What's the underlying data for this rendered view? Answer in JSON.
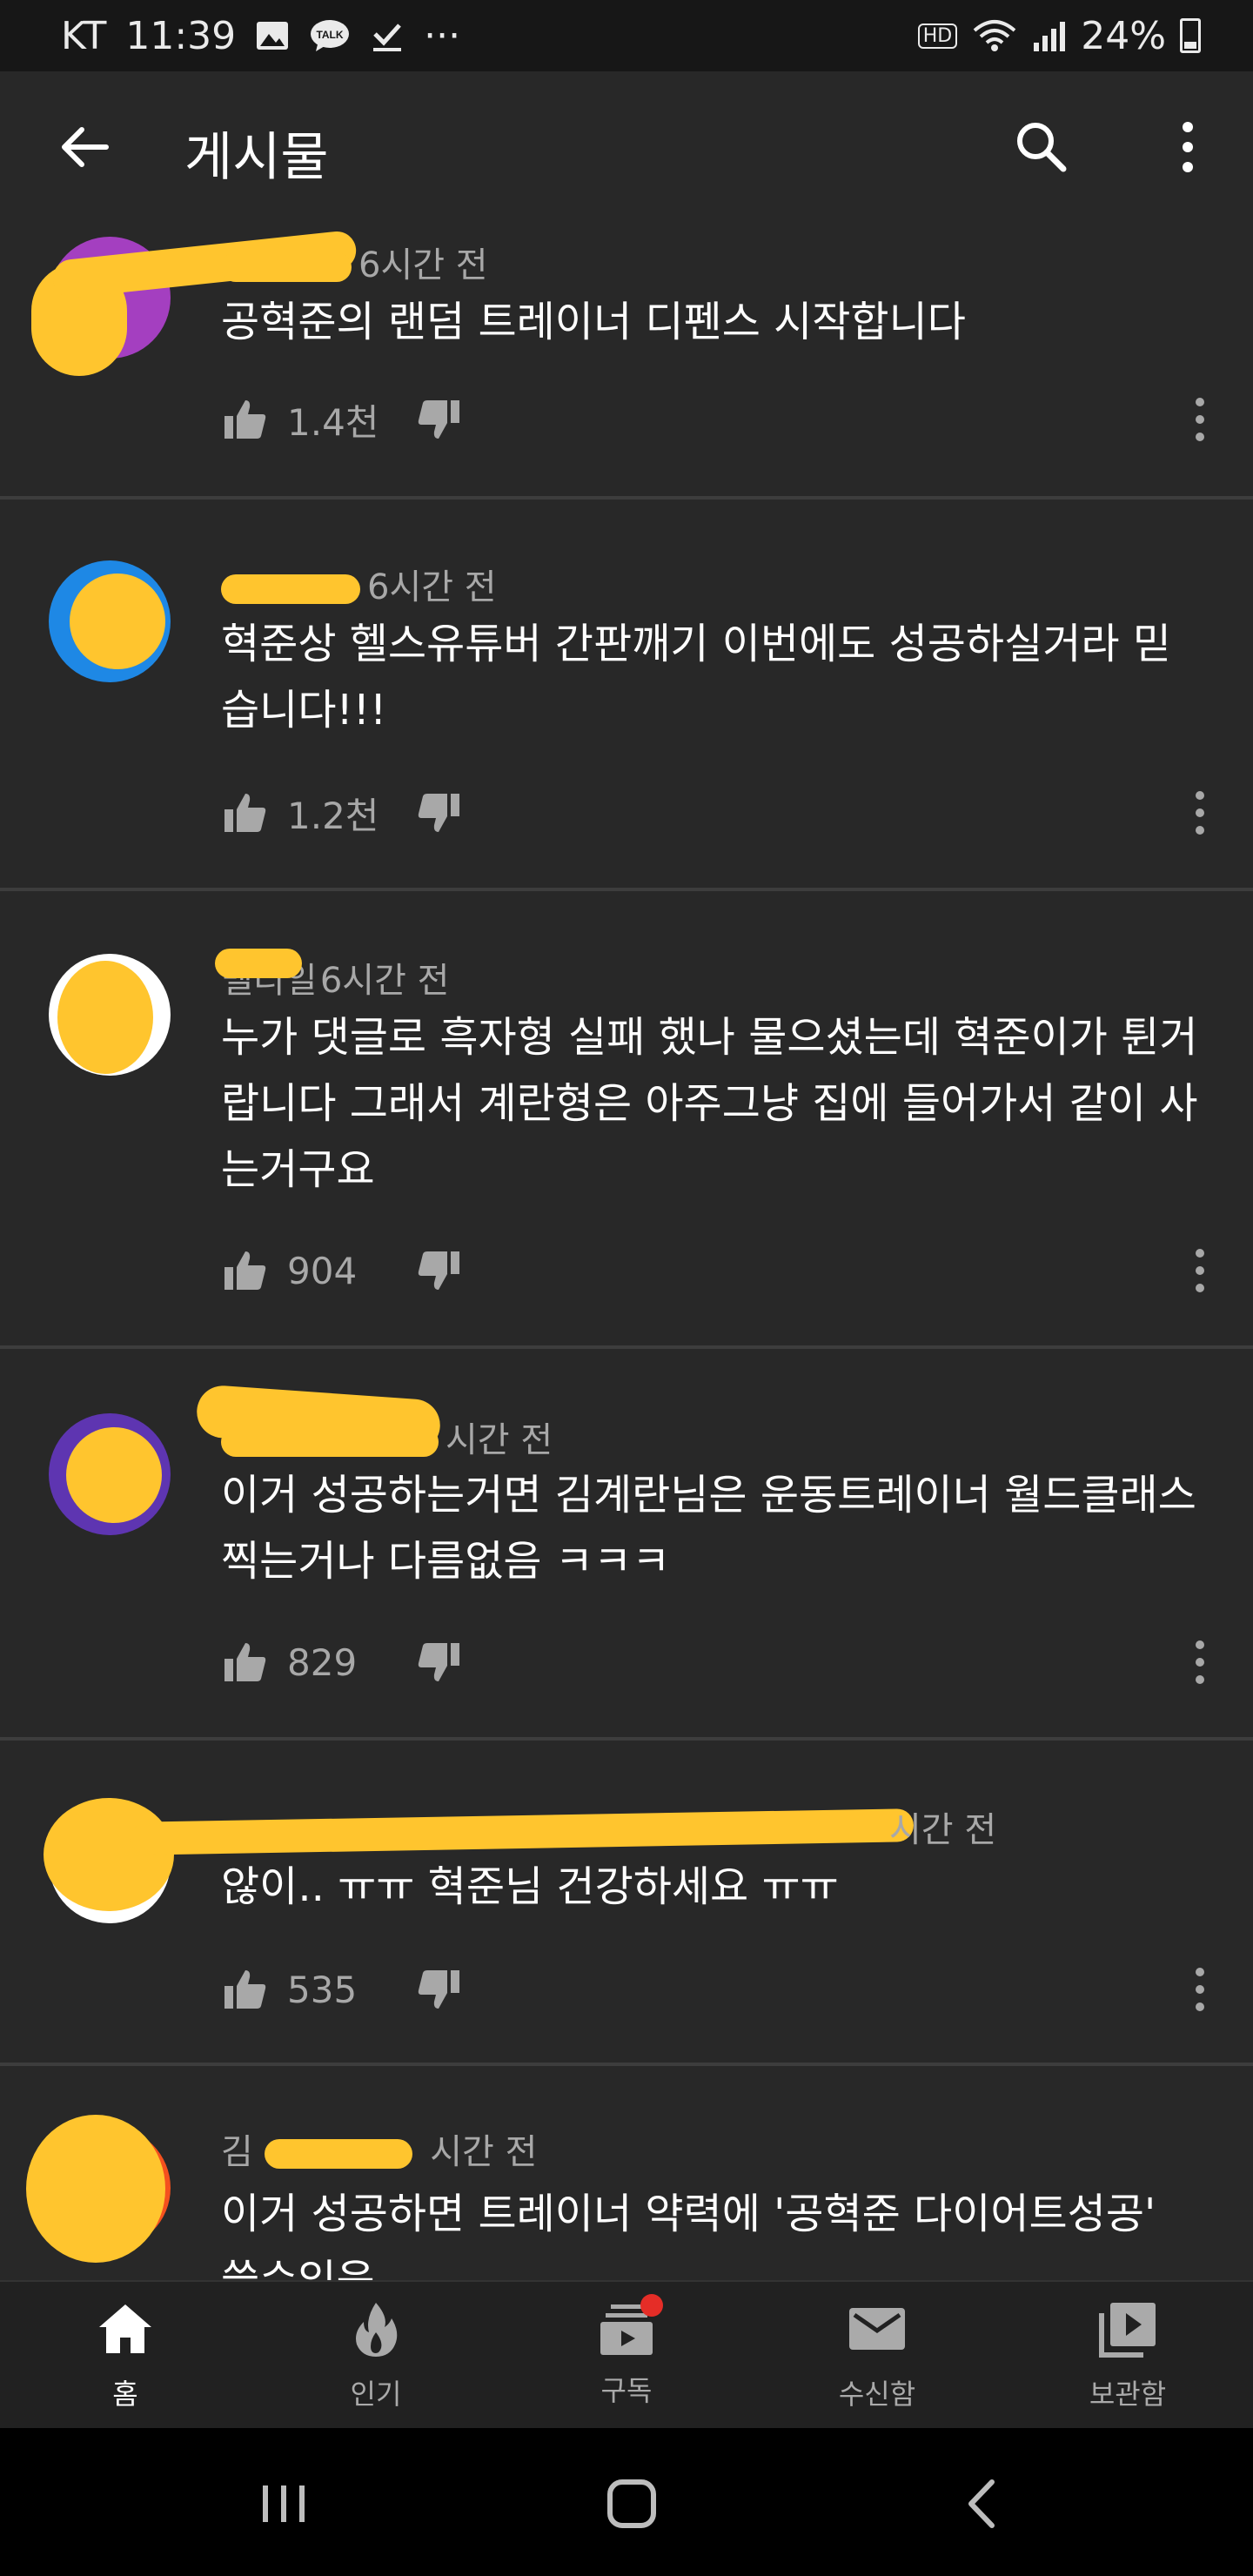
{
  "status_bar": {
    "carrier": "KT",
    "time": "11:39",
    "talk_badge": "TALK",
    "more": "···",
    "hd": "HD",
    "battery": "24%"
  },
  "app_bar": {
    "title": "게시물"
  },
  "comments": [
    {
      "author_visible": "",
      "time": "6시간 전",
      "text": "공혁준의 랜덤 트레이너 디펜스 시작합니다",
      "likes": "1.4천",
      "avatar_color": "#a43fc0"
    },
    {
      "author_visible": "",
      "time": "6시간 전",
      "text": "혁준상 헬스유튜버 간판깨기 이번에도 성공하실거라 믿습니다!!!",
      "likes": "1.2천",
      "avatar_color": "#1e88e5"
    },
    {
      "author_visible": "벨디일",
      "time": "6시간 전",
      "text": "누가 댓글로 흑자형 실패 했나 물으셨는데 혁준이가 튄거랍니다 그래서 계란형은 아주그냥 집에 들어가서 같이 사는거구요",
      "likes": "904",
      "avatar_color": "#ffffff"
    },
    {
      "author_visible": "",
      "time": "시간 전",
      "text": "이거 성공하는거면 김계란님은 운동트레이너 월드클래스 찍는거나 다름없음 ㅋㅋㅋ",
      "likes": "829",
      "avatar_color": "#5e35b1"
    },
    {
      "author_visible": "",
      "time": "시간 전",
      "text": "않이.. ㅠㅠ 혁준님 건강하세요 ㅠㅠ",
      "likes": "535",
      "avatar_color": "#ffffff"
    },
    {
      "author_visible": "김",
      "time": "시간 전",
      "text": "이거 성공하면 트레이너 약력에 '공혁준 다이어트성공' 쓸수있음",
      "likes": "",
      "avatar_color": "#f4511e"
    }
  ],
  "bottom_nav": [
    {
      "label": "홈",
      "icon": "home-icon",
      "active": true
    },
    {
      "label": "인기",
      "icon": "fire-icon",
      "active": false
    },
    {
      "label": "구독",
      "icon": "subscriptions-icon",
      "active": false
    },
    {
      "label": "수신함",
      "icon": "mail-icon",
      "active": false
    },
    {
      "label": "보관함",
      "icon": "library-icon",
      "active": false
    }
  ],
  "colors": {
    "background": "#282828",
    "redaction": "#ffc52e",
    "notification_dot": "#e52d27"
  }
}
